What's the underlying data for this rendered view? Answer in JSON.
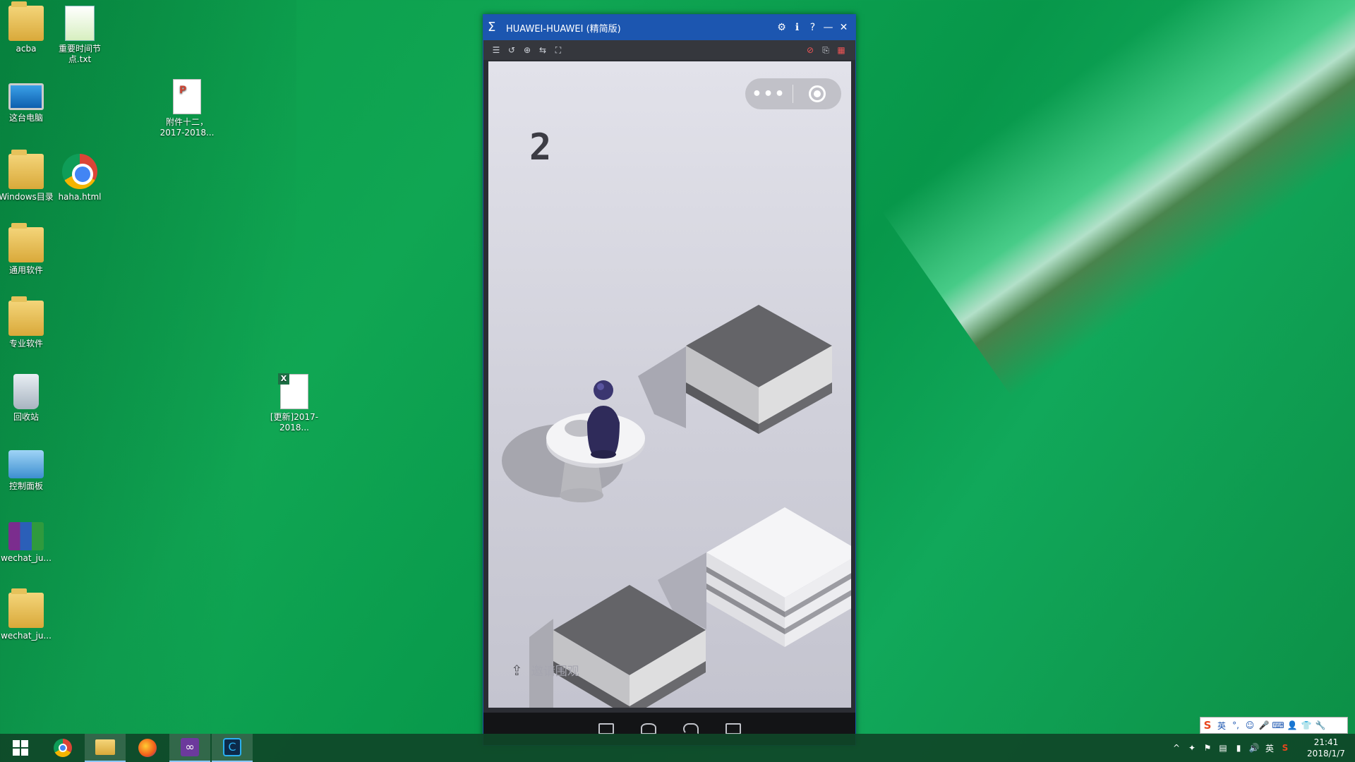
{
  "desktop": {
    "icons": [
      {
        "label": "acba",
        "icon": "folder-user-icon"
      },
      {
        "label": "重要时间节点.txt",
        "icon": "text-file-icon"
      },
      {
        "label": "这台电脑",
        "icon": "computer-icon"
      },
      {
        "label": "附件十二，2017-2018...",
        "icon": "pdf-file-icon"
      },
      {
        "label": "Windows目录",
        "icon": "folder-icon"
      },
      {
        "label": "haha.html",
        "icon": "chrome-icon"
      },
      {
        "label": "通用软件",
        "icon": "folder-icon"
      },
      {
        "label": "专业软件",
        "icon": "folder-icon"
      },
      {
        "label": "回收站",
        "icon": "recycle-bin-icon"
      },
      {
        "label": "[更新]2017-2018...",
        "icon": "spreadsheet-icon"
      },
      {
        "label": "控制面板",
        "icon": "control-panel-icon"
      },
      {
        "label": "wechat_ju...",
        "icon": "archive-icon"
      },
      {
        "label": "wechat_ju...",
        "icon": "folder-icon"
      }
    ]
  },
  "emulator": {
    "title": "HUAWEI-HUAWEI (精简版)",
    "controls": [
      "⚙",
      "ℹ",
      "?",
      "—",
      "✕"
    ],
    "toolbar": [
      "☰",
      "↺",
      "⊕",
      "⇆",
      "⛶"
    ],
    "toolbar_right": [
      "⊘",
      "⎘",
      "▦"
    ],
    "game": {
      "score": "2",
      "capsule_more": "•••",
      "share_icon": "⇪",
      "share_text": "邀请围观"
    }
  },
  "taskbar": {
    "apps": [
      "windows-start-icon",
      "chrome-icon",
      "file-explorer-icon",
      "firefox-icon",
      "visual-studio-icon",
      "terminal-icon"
    ],
    "tray": [
      "^",
      "✦",
      "⚑",
      "▤",
      "▮",
      "🔊",
      "英",
      "S"
    ],
    "time": "21:41",
    "date": "2018/1/7"
  },
  "ime": {
    "items": [
      "S",
      "英",
      "°,",
      "☺",
      "🎤",
      "⌨",
      "👤",
      "👕",
      "🔧"
    ]
  }
}
